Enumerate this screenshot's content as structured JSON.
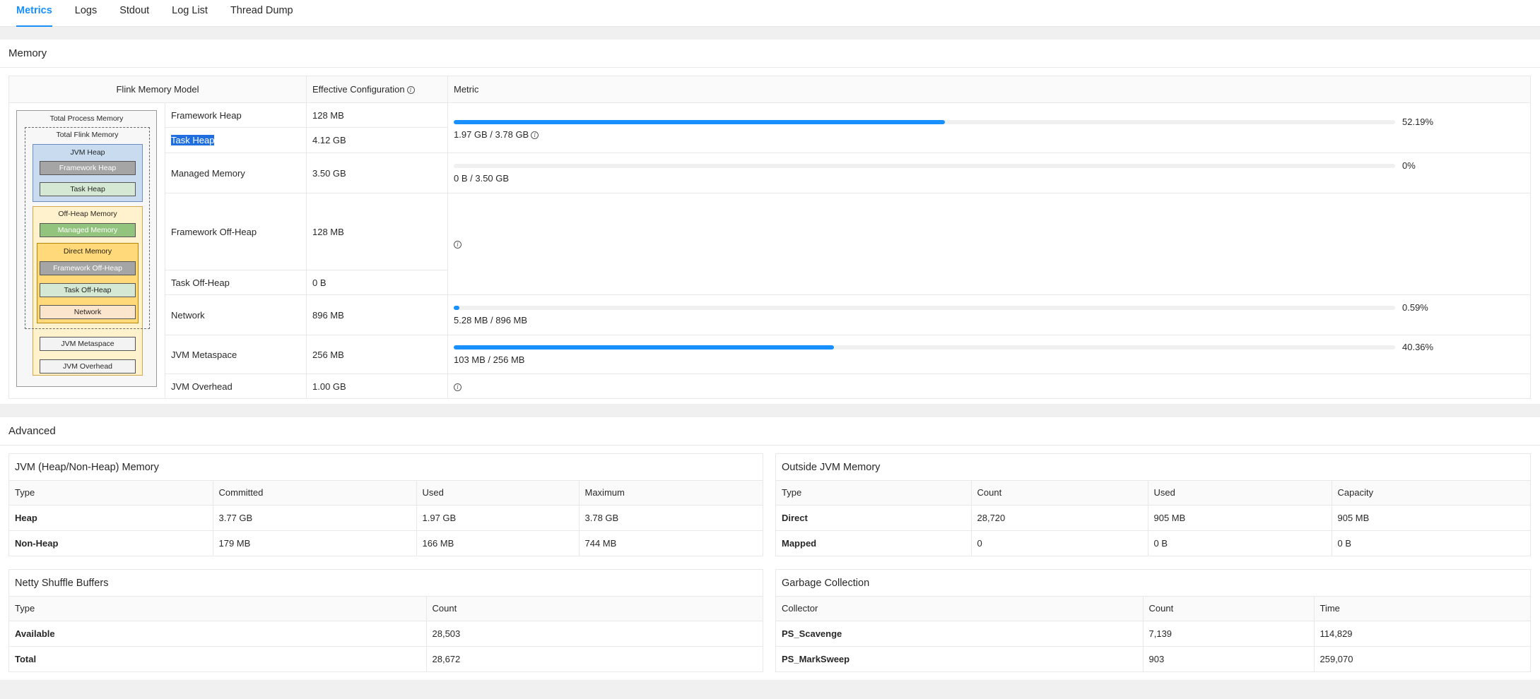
{
  "tabs": [
    {
      "label": "Metrics",
      "active": true
    },
    {
      "label": "Logs",
      "active": false
    },
    {
      "label": "Stdout",
      "active": false
    },
    {
      "label": "Log List",
      "active": false
    },
    {
      "label": "Thread Dump",
      "active": false
    }
  ],
  "memory": {
    "title": "Memory",
    "headers": {
      "model": "Flink Memory Model",
      "config": "Effective Configuration",
      "metric": "Metric"
    },
    "rows": [
      {
        "name": "Framework Heap",
        "value": "128 MB"
      },
      {
        "name": "Task Heap",
        "value": "4.12 GB"
      },
      {
        "name": "Managed Memory",
        "value": "3.50 GB"
      },
      {
        "name": "Framework Off-Heap",
        "value": "128 MB"
      },
      {
        "name": "Task Off-Heap",
        "value": "0 B"
      },
      {
        "name": "Network",
        "value": "896 MB"
      },
      {
        "name": "JVM Metaspace",
        "value": "256 MB"
      },
      {
        "name": "JVM Overhead",
        "value": "1.00 GB"
      }
    ],
    "metrics": {
      "heap": {
        "percent": 52.19,
        "pct_label": "52.19%",
        "text": "1.97 GB / 3.78 GB"
      },
      "managed": {
        "percent": 0,
        "pct_label": "0%",
        "text": "0 B / 3.50 GB"
      },
      "network": {
        "percent": 0.59,
        "pct_label": "0.59%",
        "text": "5.28 MB / 896 MB"
      },
      "metaspace": {
        "percent": 40.36,
        "pct_label": "40.36%",
        "text": "103 MB / 256 MB"
      }
    },
    "diagram": {
      "total_process": "Total Process Memory",
      "total_flink": "Total Flink Memory",
      "jvm_heap": "JVM Heap",
      "framework_heap": "Framework Heap",
      "task_heap": "Task Heap",
      "off_heap": "Off-Heap Memory",
      "managed": "Managed Memory",
      "direct": "Direct Memory",
      "framework_off_heap": "Framework Off-Heap",
      "task_off_heap": "Task Off-Heap",
      "network": "Network",
      "jvm_metaspace": "JVM Metaspace",
      "jvm_overhead": "JVM Overhead"
    }
  },
  "advanced": {
    "title": "Advanced",
    "jvm": {
      "title": "JVM (Heap/Non-Heap) Memory",
      "headers": [
        "Type",
        "Committed",
        "Used",
        "Maximum"
      ],
      "rows": [
        [
          "Heap",
          "3.77 GB",
          "1.97 GB",
          "3.78 GB"
        ],
        [
          "Non-Heap",
          "179 MB",
          "166 MB",
          "744 MB"
        ]
      ]
    },
    "outside": {
      "title": "Outside JVM Memory",
      "headers": [
        "Type",
        "Count",
        "Used",
        "Capacity"
      ],
      "rows": [
        [
          "Direct",
          "28,720",
          "905 MB",
          "905 MB"
        ],
        [
          "Mapped",
          "0",
          "0 B",
          "0 B"
        ]
      ]
    },
    "netty": {
      "title": "Netty Shuffle Buffers",
      "headers": [
        "Type",
        "Count"
      ],
      "rows": [
        [
          "Available",
          "28,503"
        ],
        [
          "Total",
          "28,672"
        ]
      ]
    },
    "gc": {
      "title": "Garbage Collection",
      "headers": [
        "Collector",
        "Count",
        "Time"
      ],
      "rows": [
        [
          "PS_Scavenge",
          "7,139",
          "114,829"
        ],
        [
          "PS_MarkSweep",
          "903",
          "259,070"
        ]
      ]
    }
  }
}
